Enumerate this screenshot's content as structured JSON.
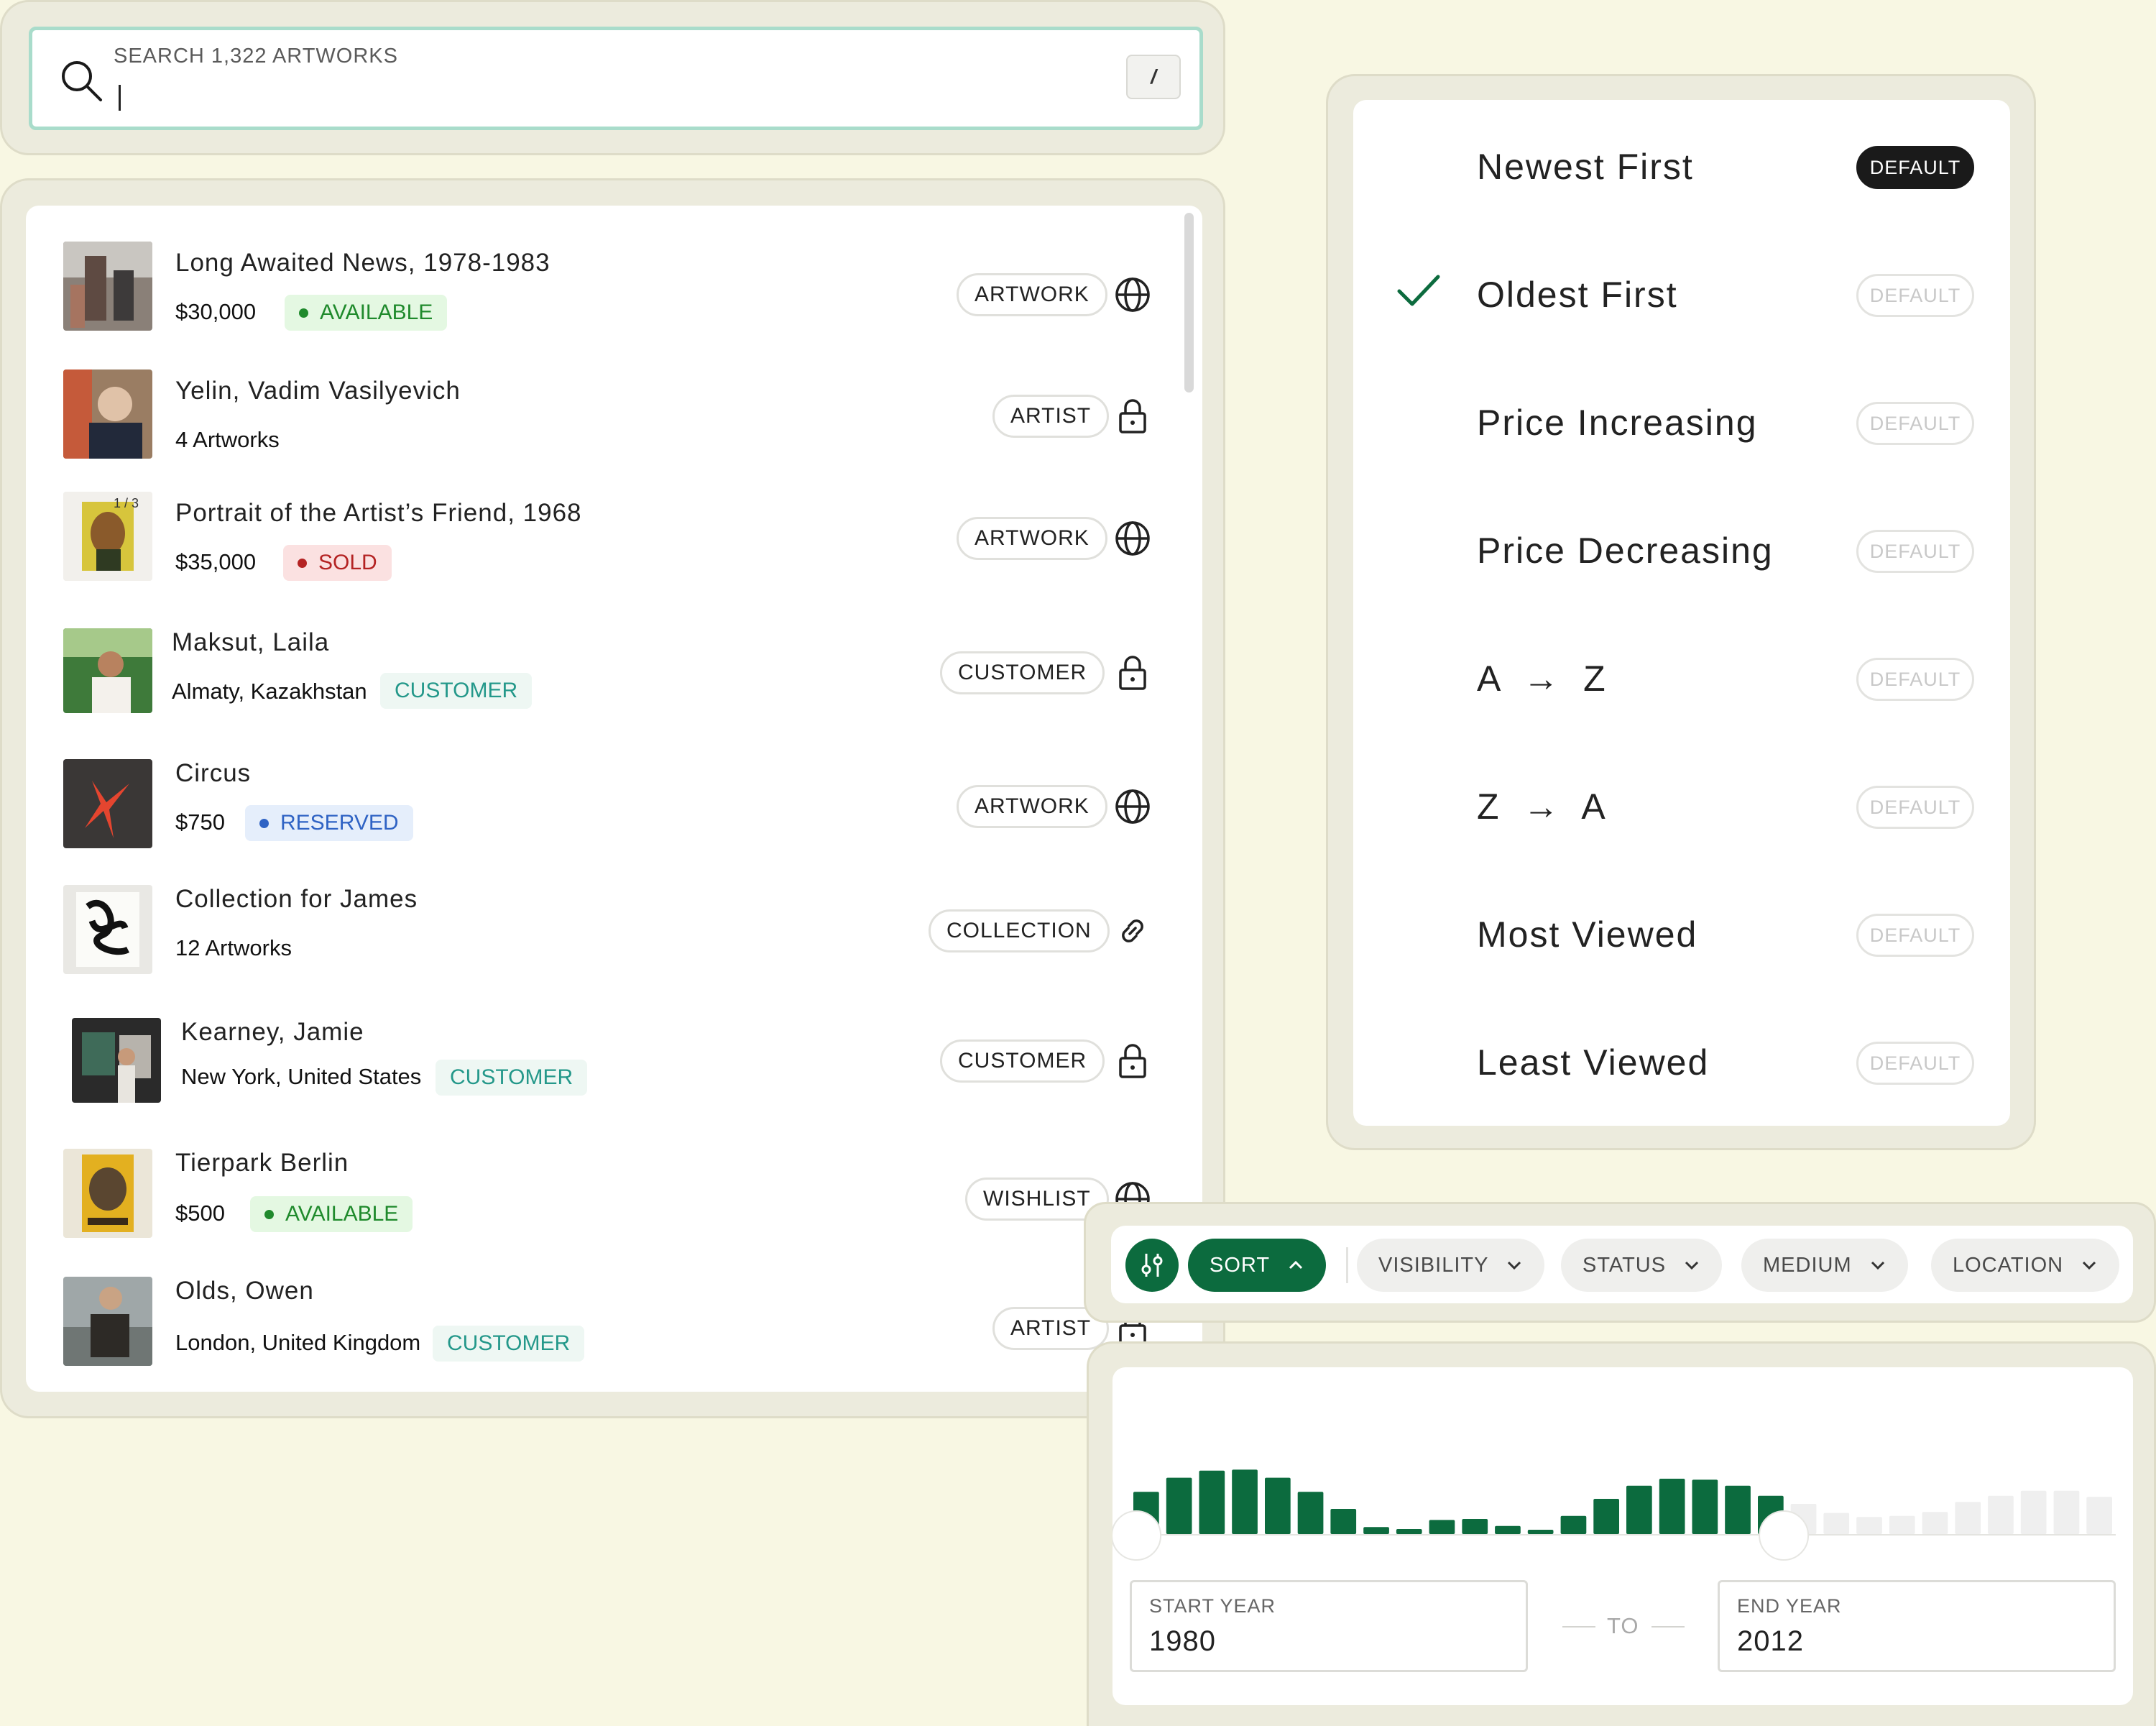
{
  "search": {
    "label": "SEARCH 1,322 ARTWORKS",
    "value": "",
    "shortcut": "/"
  },
  "results": [
    {
      "title": "Long Awaited News, 1978-1983",
      "price": "$30,000",
      "status": "AVAILABLE",
      "type": "ARTWORK",
      "icon": "globe-icon"
    },
    {
      "title": "Yelin, Vadim Vasilyevich",
      "sub": "4 Artworks",
      "type": "ARTIST",
      "icon": "lock-icon"
    },
    {
      "title": "Portrait of the Artist’s Friend, 1968",
      "price": "$35,000",
      "status": "SOLD",
      "type": "ARTWORK",
      "icon": "globe-icon",
      "thumb_badge": "1 / 3"
    },
    {
      "title": "Maksut, Laila",
      "sub": "Almaty, Kazakhstan",
      "tag": "CUSTOMER",
      "type": "CUSTOMER",
      "icon": "lock-icon"
    },
    {
      "title": "Circus",
      "price": "$750",
      "status": "RESERVED",
      "type": "ARTWORK",
      "icon": "globe-icon"
    },
    {
      "title": "Collection for James",
      "sub": "12 Artworks",
      "type": "COLLECTION",
      "icon": "link-icon"
    },
    {
      "title": "Kearney, Jamie",
      "sub": "New York, United States",
      "tag": "CUSTOMER",
      "type": "CUSTOMER",
      "icon": "lock-icon"
    },
    {
      "title": "Tierpark Berlin",
      "price": "$500",
      "status": "AVAILABLE",
      "type": "WISHLIST",
      "icon": "globe-icon"
    },
    {
      "title": "Olds, Owen",
      "sub": "London, United Kingdom",
      "tag": "CUSTOMER",
      "type": "ARTIST",
      "icon": "lock-icon"
    }
  ],
  "sort_menu": {
    "selected": "Oldest First",
    "default_active": "Newest First",
    "items": [
      {
        "label": "Newest First",
        "pill": "DEFAULT"
      },
      {
        "label": "Oldest First",
        "pill": "DEFAULT"
      },
      {
        "label": "Price Increasing",
        "pill": "DEFAULT"
      },
      {
        "label": "Price Decreasing",
        "pill": "DEFAULT"
      },
      {
        "label": "A  →  Z",
        "pill": "DEFAULT"
      },
      {
        "label": "Z  →  A",
        "pill": "DEFAULT"
      },
      {
        "label": "Most Viewed",
        "pill": "DEFAULT"
      },
      {
        "label": "Least Viewed",
        "pill": "DEFAULT"
      }
    ]
  },
  "filters": {
    "sort": "SORT",
    "visibility": "VISIBILITY",
    "status": "STATUS",
    "medium": "MEDIUM",
    "location": "LOCATION"
  },
  "year_range": {
    "start_label": "START YEAR",
    "start_value": "1980",
    "end_label": "END YEAR",
    "end_value": "2012",
    "separator": "TO",
    "histogram": [
      0.42,
      0.56,
      0.63,
      0.64,
      0.56,
      0.42,
      0.25,
      0.07,
      0.05,
      0.14,
      0.15,
      0.08,
      0.03,
      0.18,
      0.35,
      0.48,
      0.55,
      0.54,
      0.48,
      0.38,
      0.3,
      0.21,
      0.17,
      0.18,
      0.22,
      0.32,
      0.38,
      0.43,
      0.43,
      0.37
    ],
    "selected_bars": [
      0,
      19
    ]
  },
  "colors": {
    "accent": "#0c6b3e",
    "bar_inactive": "#efefef",
    "background": "#f8f7e3"
  }
}
